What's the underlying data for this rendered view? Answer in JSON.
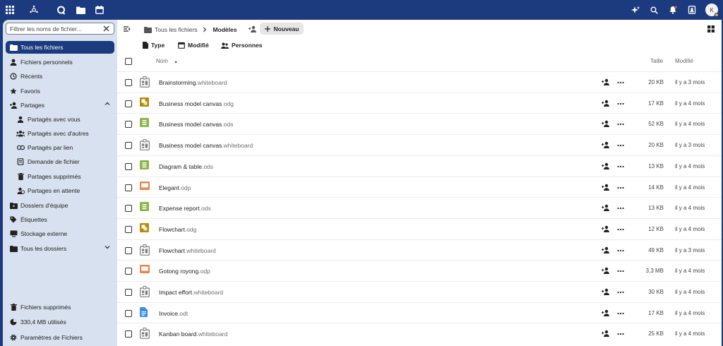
{
  "header": {
    "avatar_initial": "K",
    "icons": [
      "apps-grid-icon",
      "dashboard-icon",
      "activity-icon",
      "files-icon",
      "calendar-icon",
      "assistant-icon",
      "search-icon",
      "notifications-icon",
      "contacts-icon"
    ]
  },
  "sidebar": {
    "filter_placeholder": "Filtrer les noms de fichier...",
    "items": [
      {
        "label": "Tous les fichiers",
        "icon": "folder-icon"
      },
      {
        "label": "Fichiers personnels",
        "icon": "person-icon"
      },
      {
        "label": "Récents",
        "icon": "history-icon"
      },
      {
        "label": "Favoris",
        "icon": "star-icon"
      },
      {
        "label": "Partages",
        "icon": "share-icon"
      },
      {
        "label": "Partagés avec vous",
        "icon": "person-icon"
      },
      {
        "label": "Partagés avec d'autres",
        "icon": "group-icon"
      },
      {
        "label": "Partagés par lien",
        "icon": "link-icon"
      },
      {
        "label": "Demande de fichier",
        "icon": "file-request-icon"
      },
      {
        "label": "Partages supprimés",
        "icon": "trash-icon"
      },
      {
        "label": "Partages en attente",
        "icon": "pending-share-icon"
      },
      {
        "label": "Dossiers d'équipe",
        "icon": "team-folder-icon"
      },
      {
        "label": "Étiquettes",
        "icon": "tag-icon"
      },
      {
        "label": "Stockage externe",
        "icon": "monitor-icon"
      },
      {
        "label": "Tous les dossiers",
        "icon": "folder-icon"
      }
    ],
    "bottom": [
      {
        "label": "Fichiers supprimés",
        "icon": "trash-icon"
      },
      {
        "label": "330,4 MB utilisés",
        "icon": "quota-pie-icon"
      },
      {
        "label": "Paramètres de Fichiers",
        "icon": "gear-icon"
      }
    ]
  },
  "breadcrumb": {
    "root": "Tous les fichiers",
    "current": "Modèles"
  },
  "toolbar": {
    "new_label": "Nouveau"
  },
  "filters": {
    "type": "Type",
    "modified": "Modifié",
    "people": "Personnes"
  },
  "table": {
    "headers": {
      "name": "Nom",
      "size": "Taille",
      "modified": "Modifié"
    },
    "rows": [
      {
        "name": "Brainstorming",
        "ext": ".whiteboard",
        "kind": "whiteboard",
        "size": "20 KB",
        "modified": "il y a 3 mois"
      },
      {
        "name": "Business model canvas",
        "ext": ".odg",
        "kind": "odg",
        "size": "17 KB",
        "modified": "il y a 4 mois"
      },
      {
        "name": "Business model canvas",
        "ext": ".ods",
        "kind": "ods",
        "size": "52 KB",
        "modified": "il y a 4 mois"
      },
      {
        "name": "Business model canvas",
        "ext": ".whiteboard",
        "kind": "whiteboard",
        "size": "20 KB",
        "modified": "il y a 3 mois"
      },
      {
        "name": "Diagram & table",
        "ext": ".ods",
        "kind": "ods",
        "size": "13 KB",
        "modified": "il y a 4 mois"
      },
      {
        "name": "Elegant",
        "ext": ".odp",
        "kind": "odp",
        "size": "14 KB",
        "modified": "il y a 4 mois"
      },
      {
        "name": "Expense report",
        "ext": ".ods",
        "kind": "ods",
        "size": "13 KB",
        "modified": "il y a 4 mois"
      },
      {
        "name": "Flowchart",
        "ext": ".odg",
        "kind": "odg",
        "size": "12 KB",
        "modified": "il y a 4 mois"
      },
      {
        "name": "Flowchart",
        "ext": ".whiteboard",
        "kind": "whiteboard",
        "size": "49 KB",
        "modified": "il y a 3 mois"
      },
      {
        "name": "Gotong royong",
        "ext": ".odp",
        "kind": "odp",
        "size": "3,3 MB",
        "modified": "il y a 4 mois"
      },
      {
        "name": "Impact effort",
        "ext": ".whiteboard",
        "kind": "whiteboard",
        "size": "30 KB",
        "modified": "il y a 4 mois"
      },
      {
        "name": "Invoice",
        "ext": ".odt",
        "kind": "odt",
        "size": "17 KB",
        "modified": "il y a 4 mois"
      },
      {
        "name": "Kanban board",
        "ext": ".whiteboard",
        "kind": "whiteboard",
        "size": "25 KB",
        "modified": "il y a 4 mois"
      }
    ]
  },
  "colors": {
    "header_bg": "#1b3b7e",
    "sidebar_bg": "#d7e1ef",
    "odg": "#b58c07",
    "ods": "#8db44a",
    "odp": "#e8874a",
    "odt": "#3c8ee6",
    "whiteboard": "#7a7a7a"
  }
}
